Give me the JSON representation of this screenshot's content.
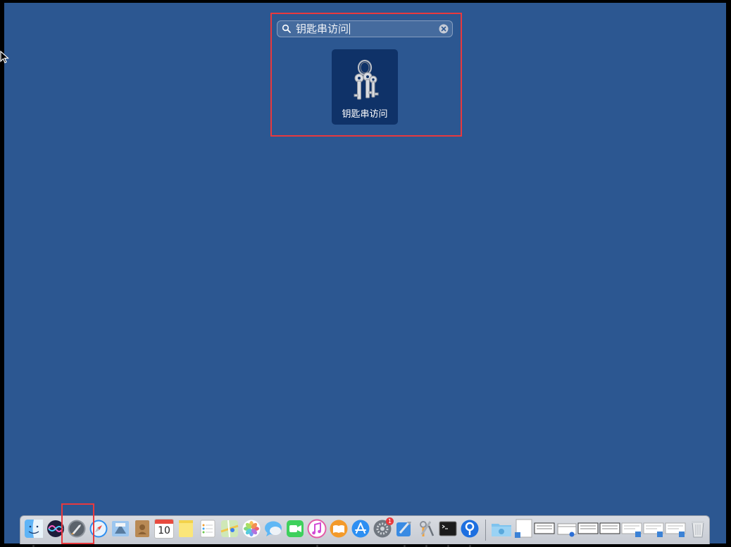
{
  "launchpad": {
    "search_query": "钥匙串访问",
    "result_app_label": "钥匙串访问"
  },
  "dock": {
    "calendar_day": "10",
    "system_prefs_badge": "1",
    "items": [
      "finder-icon",
      "siri-icon",
      "launchpad-icon",
      "safari-icon",
      "mail-icon",
      "contacts-icon",
      "calendar-icon",
      "notes-icon",
      "reminders-icon",
      "maps-icon",
      "photos-icon",
      "messages-icon",
      "facetime-icon",
      "itunes-icon",
      "books-icon",
      "app-store-icon",
      "system-preferences-icon",
      "xcode-icon",
      "keychain-icon",
      "terminal-icon",
      "sourcetree-icon",
      "downloads-folder-icon",
      "document-icon",
      "window-thumbnail-icon",
      "folder-icon",
      "window-thumbnail-icon",
      "window-thumbnail-icon",
      "window-thumbnail-icon",
      "window-thumbnail-icon",
      "window-thumbnail-icon",
      "trash-icon"
    ]
  },
  "colors": {
    "desktop": "#2c5791",
    "tile": "#0f3268",
    "highlight": "#e8393e"
  }
}
